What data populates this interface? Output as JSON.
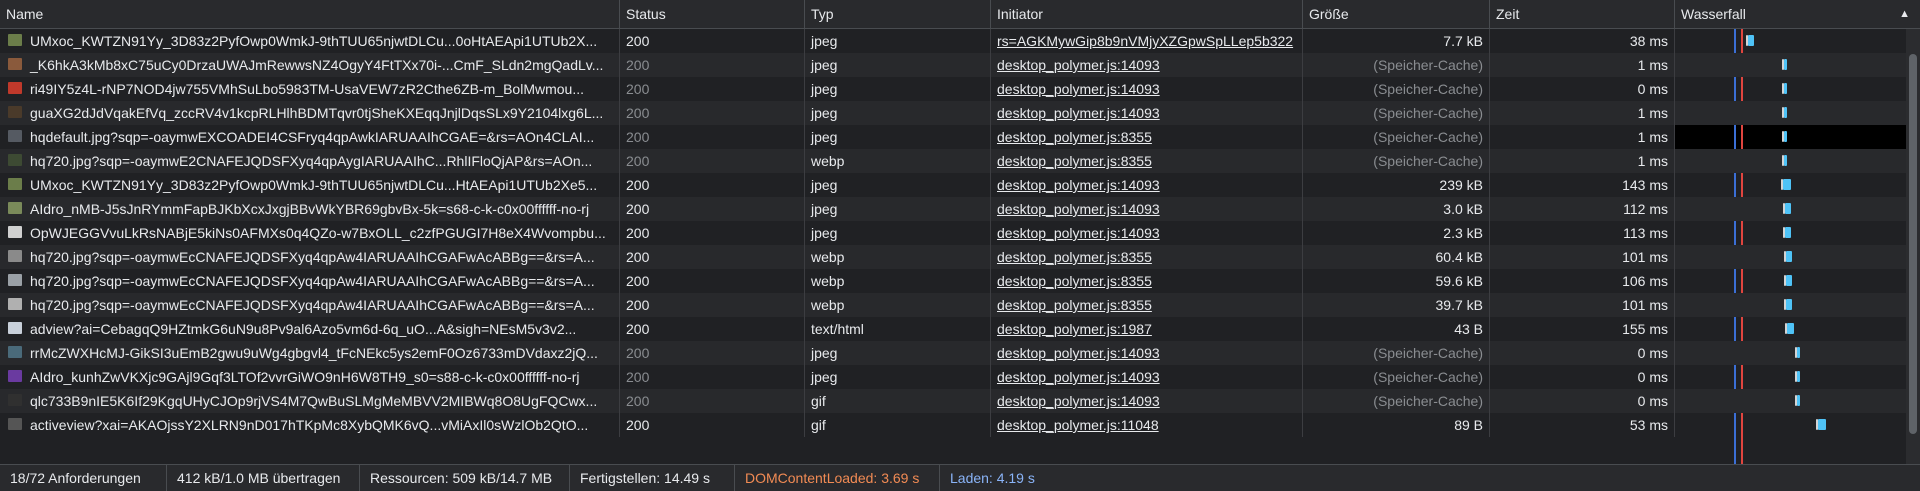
{
  "columns": {
    "name": "Name",
    "status": "Status",
    "type": "Typ",
    "initiator": "Initiator",
    "size": "Größe",
    "time": "Zeit",
    "waterfall": "Wasserfall"
  },
  "rows": [
    {
      "name": "UMxoc_KWTZN91Yy_3D83z2PyfOwp0WmkJ-9thTUU65njwtDLCu...0oHtAEApi1UTUb2X...",
      "status": "200",
      "type": "jpeg",
      "initiator": "rs=AGKMywGip8b9nVMjyXZGpwSpLLep5b322",
      "size": "7.7 kB",
      "time": "38 ms",
      "icon_color": "#6b7d4a"
    },
    {
      "name": "_K6hkA3kMb8xC75uCy0DrzaUWAJmRewwsNZ4OgyY4FtTXx70i-...CmF_SLdn2mgQadLv...",
      "status": "200",
      "type": "jpeg",
      "initiator": "desktop_polymer.js:14093",
      "size": "(Speicher-Cache)",
      "time": "1 ms",
      "icon_color": "#8a5a3c"
    },
    {
      "name": "ri49IY5z4L-rNP7NOD4jw755VMhSuLbo5983TM-UsaVEW7zR2Cthe6ZB-m_BolMwmou...",
      "status": "200",
      "type": "jpeg",
      "initiator": "desktop_polymer.js:14093",
      "size": "(Speicher-Cache)",
      "time": "0 ms",
      "icon_color": "#c0392b"
    },
    {
      "name": "guaXG2dJdVqakEfVq_zccRV4v1kcpRLHlhBDMTqvr0tjSheKXEqqJnjlDqsSLx9Y2104lxg6L...",
      "status": "200",
      "type": "jpeg",
      "initiator": "desktop_polymer.js:14093",
      "size": "(Speicher-Cache)",
      "time": "1 ms",
      "icon_color": "#4a3a2a"
    },
    {
      "name": "hqdefault.jpg?sqp=-oaymwEXCOADEI4CSFryq4qpAwkIARUAAIhCGAE=&rs=AOn4CLAI...",
      "status": "200",
      "type": "jpeg",
      "initiator": "desktop_polymer.js:8355",
      "size": "(Speicher-Cache)",
      "time": "1 ms",
      "icon_color": "#555a62"
    },
    {
      "name": "hq720.jpg?sqp=-oaymwE2CNAFEJQDSFXyq4qpAygIARUAAIhC...RhlIFloQjAP&rs=AOn...",
      "status": "200",
      "type": "webp",
      "initiator": "desktop_polymer.js:8355",
      "size": "(Speicher-Cache)",
      "time": "1 ms",
      "icon_color": "#3d4a33"
    },
    {
      "name": "UMxoc_KWTZN91Yy_3D83z2PyfOwp0WmkJ-9thTUU65njwtDLCu...HtAEApi1UTUb2Xe5...",
      "status": "200",
      "type": "jpeg",
      "initiator": "desktop_polymer.js:14093",
      "size": "239 kB",
      "time": "143 ms",
      "icon_color": "#6b7d4a"
    },
    {
      "name": "AIdro_nMB-J5sJnRYmmFapBJKbXcxJxgjBBvWkYBR69gbvBx-5k=s68-c-k-c0x00ffffff-no-rj",
      "status": "200",
      "type": "jpeg",
      "initiator": "desktop_polymer.js:14093",
      "size": "3.0 kB",
      "time": "112 ms",
      "icon_color": "#7a8a5a"
    },
    {
      "name": "OpWJEGGVvuLkRsNABjE5kiNs0AFMXs0q4QZo-w7BxOLL_c2zfPGUGI7H8eX4Wvompbu...",
      "status": "200",
      "type": "jpeg",
      "initiator": "desktop_polymer.js:14093",
      "size": "2.3 kB",
      "time": "113 ms",
      "icon_color": "#d0d0d0"
    },
    {
      "name": "hq720.jpg?sqp=-oaymwEcCNAFEJQDSFXyq4qpAw4IARUAAIhCGAFwAcABBg==&rs=A...",
      "status": "200",
      "type": "webp",
      "initiator": "desktop_polymer.js:8355",
      "size": "60.4 kB",
      "time": "101 ms",
      "icon_color": "#8a8a8a"
    },
    {
      "name": "hq720.jpg?sqp=-oaymwEcCNAFEJQDSFXyq4qpAw4IARUAAIhCGAFwAcABBg==&rs=A...",
      "status": "200",
      "type": "webp",
      "initiator": "desktop_polymer.js:8355",
      "size": "59.6 kB",
      "time": "106 ms",
      "icon_color": "#9aa0a6"
    },
    {
      "name": "hq720.jpg?sqp=-oaymwEcCNAFEJQDSFXyq4qpAw4IARUAAIhCGAFwAcABBg==&rs=A...",
      "status": "200",
      "type": "webp",
      "initiator": "desktop_polymer.js:8355",
      "size": "39.7 kB",
      "time": "101 ms",
      "icon_color": "#b0b0b0"
    },
    {
      "name": "adview?ai=CebagqQ9HZtmkG6uN9u8Pv9al6Azo5vm6d-6q_uO...A&sigh=NEsM5v3v2...",
      "status": "200",
      "type": "text/html",
      "initiator": "desktop_polymer.js:1987",
      "size": "43 B",
      "time": "155 ms",
      "icon_color": "#c8d0da"
    },
    {
      "name": "rrMcZWXHcMJ-GikSI3uEmB2gwu9uWg4gbgvl4_tFcNEkc5ys2emF0Oz6733mDVdaxz2jQ...",
      "status": "200",
      "type": "jpeg",
      "initiator": "desktop_polymer.js:14093",
      "size": "(Speicher-Cache)",
      "time": "0 ms",
      "icon_color": "#4a6a7a"
    },
    {
      "name": "AIdro_kunhZwVKXjc9GAjl9Gqf3LTOf2vvrGiWO9nH6W8TH9_s0=s88-c-k-c0x00ffffff-no-rj",
      "status": "200",
      "type": "jpeg",
      "initiator": "desktop_polymer.js:14093",
      "size": "(Speicher-Cache)",
      "time": "0 ms",
      "icon_color": "#6a3aa0"
    },
    {
      "name": "qlc733B9nIE5K6If29KgqUHyCJOp9rjVS4M7QwBuSLMgMeMBVV2MIBWq8O8UgFQCwx...",
      "status": "200",
      "type": "gif",
      "initiator": "desktop_polymer.js:14093",
      "size": "(Speicher-Cache)",
      "time": "0 ms",
      "icon_color": "#303030"
    },
    {
      "name": "activeview?xai=AKAOjssY2XLRN9nD017hTKpMc8XybQMK6vQ...vMiAxIl0sWzlOb2QtO...",
      "status": "200",
      "type": "gif",
      "initiator": "desktop_polymer.js:11048",
      "size": "89 B",
      "time": "53 ms",
      "icon_color": "#555555"
    }
  ],
  "status_bar": {
    "requests": "18/72 Anforderungen",
    "transferred": "412 kB/1.0 MB übertragen",
    "resources": "Ressourcen: 509 kB/14.7 MB",
    "finish": "Fertigstellen: 14.49 s",
    "dom_loaded": "DOMContentLoaded: 3.69 s",
    "load": "Laden: 4.19 s"
  },
  "colors": {
    "dom_loaded": "#f28b54",
    "load": "#8ab4f8",
    "waterfall_bar": "#4fc3f7",
    "waterfall_wait": "#d4d4d4"
  }
}
